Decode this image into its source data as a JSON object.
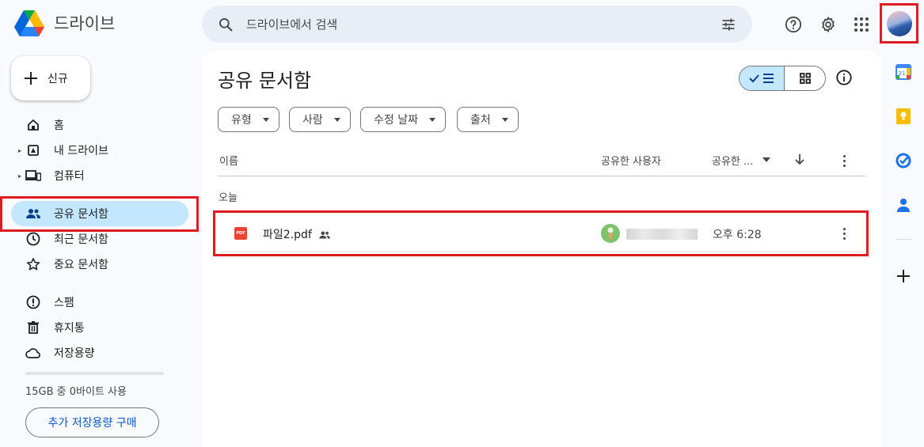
{
  "header": {
    "app_name": "드라이브",
    "search_placeholder": "드라이브에서 검색"
  },
  "sidebar": {
    "new_label": "신규",
    "items": [
      {
        "label": "홈",
        "icon": "home-icon"
      },
      {
        "label": "내 드라이브",
        "icon": "my-drive-icon"
      },
      {
        "label": "컴퓨터",
        "icon": "computer-icon"
      },
      {
        "label": "공유 문서함",
        "icon": "shared-people-icon",
        "active": true
      },
      {
        "label": "최근 문서함",
        "icon": "clock-icon"
      },
      {
        "label": "중요 문서함",
        "icon": "star-icon"
      },
      {
        "label": "스팸",
        "icon": "spam-icon"
      },
      {
        "label": "휴지통",
        "icon": "trash-icon"
      },
      {
        "label": "저장용량",
        "icon": "cloud-icon"
      }
    ],
    "storage_text": "15GB 중 0바이트 사용",
    "storage_fraction": 0,
    "buy_storage_label": "추가 저장용량 구매"
  },
  "main": {
    "title": "공유 문서함",
    "filters": [
      "유형",
      "사람",
      "수정 날짜",
      "출처"
    ],
    "columns": {
      "name": "이름",
      "sharer": "공유한 사용자",
      "shared_date": "공유한 ..."
    },
    "group_label": "오늘",
    "files": [
      {
        "name": "파일2.pdf",
        "type_badge": "PDF",
        "shared_time": "오후 6:28"
      }
    ]
  },
  "colors": {
    "accent": "#0b57d0",
    "active_nav": "#c2e7ff",
    "highlight_box": "#e11b22",
    "search_bg": "#e9eef6"
  }
}
